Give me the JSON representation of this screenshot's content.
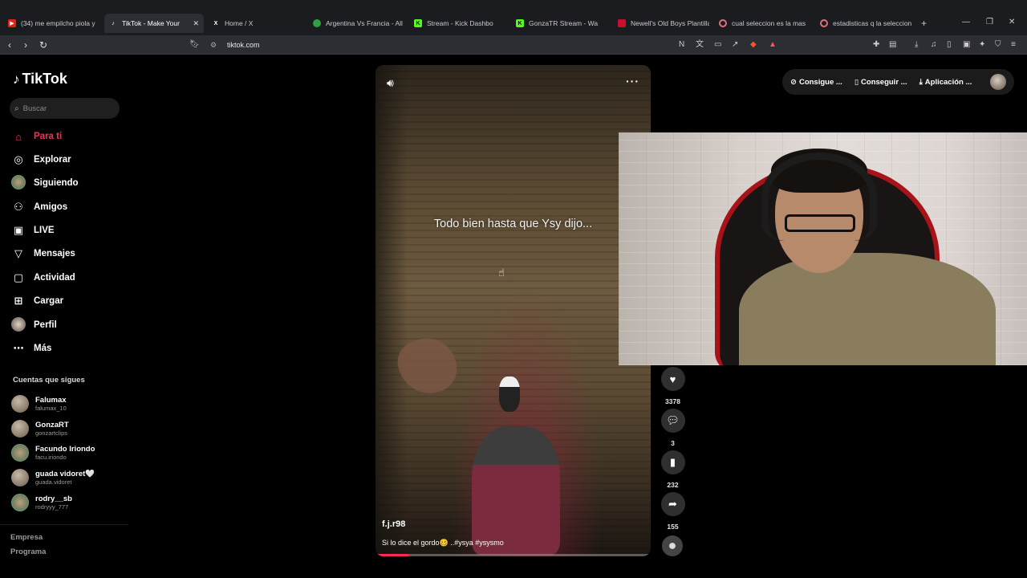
{
  "browser": {
    "tabs": [
      {
        "label": "(34) me empilcho piola y",
        "icon": "youtube-icon",
        "active": false
      },
      {
        "label": "TikTok - Make Your",
        "icon": "tiktok-icon",
        "active": true
      },
      {
        "label": "Home / X",
        "icon": "x-icon",
        "active": false
      },
      {
        "label": "Argentina Vs Francia - All",
        "icon": "globe-icon",
        "active": false
      },
      {
        "label": "Stream - Kick Dashbo",
        "icon": "kick-icon",
        "active": false
      },
      {
        "label": "GonzaTR Stream - Wa",
        "icon": "kick-icon",
        "active": false
      },
      {
        "label": "Newell's Old Boys Plantilla",
        "icon": "page-icon",
        "active": false
      },
      {
        "label": "cual seleccion es la mas",
        "icon": "search-icon",
        "active": false
      },
      {
        "label": "estadisticas q la seleccion",
        "icon": "search-icon",
        "active": false
      }
    ],
    "new_tab": "+",
    "url": "tiktok.com"
  },
  "tiktok": {
    "logo": "TikTok",
    "search_placeholder": "Buscar",
    "nav": [
      {
        "label": "Para ti",
        "icon": "home-icon",
        "active": true
      },
      {
        "label": "Explorar",
        "icon": "compass-icon",
        "active": false
      },
      {
        "label": "Siguiendo",
        "icon": "following-avatar-icon",
        "active": false
      },
      {
        "label": "Amigos",
        "icon": "friends-icon",
        "active": false
      },
      {
        "label": "LIVE",
        "icon": "live-icon",
        "active": false
      },
      {
        "label": "Mensajes",
        "icon": "send-icon",
        "active": false
      },
      {
        "label": "Actividad",
        "icon": "activity-icon",
        "active": false
      },
      {
        "label": "Cargar",
        "icon": "upload-icon",
        "active": false
      },
      {
        "label": "Perfil",
        "icon": "profile-avatar-icon",
        "active": false
      },
      {
        "label": "Más",
        "icon": "more-icon",
        "active": false
      }
    ],
    "following_header": "Cuentas que sigues",
    "following": [
      {
        "name": "Falumax",
        "username": "falumax_10"
      },
      {
        "name": "GonzaRT",
        "username": "gonzartclips"
      },
      {
        "name": "Facundo Iriondo",
        "username": "facu.iriondo"
      },
      {
        "name": "guada vidoret🤍",
        "username": "guada.vidoret"
      },
      {
        "name": "rodry__sb",
        "username": "rodryyy_777"
      }
    ],
    "footer": [
      "Empresa",
      "Programa"
    ],
    "top_actions": [
      "Consigue ...",
      "Conseguir ...",
      "Aplicación ..."
    ],
    "video": {
      "overlay_text": "Todo bien hasta que Ysy dijo...",
      "author": "f.j.r98",
      "description": "Si lo dice el gordo🥴 ..#ysya #ysysmo",
      "progress": 0.12
    },
    "actions": [
      {
        "icon": "heart-icon",
        "count": "3378"
      },
      {
        "icon": "comment-icon",
        "count": "3"
      },
      {
        "icon": "bookmark-icon",
        "count": "232"
      },
      {
        "icon": "share-icon",
        "count": "155"
      }
    ]
  }
}
